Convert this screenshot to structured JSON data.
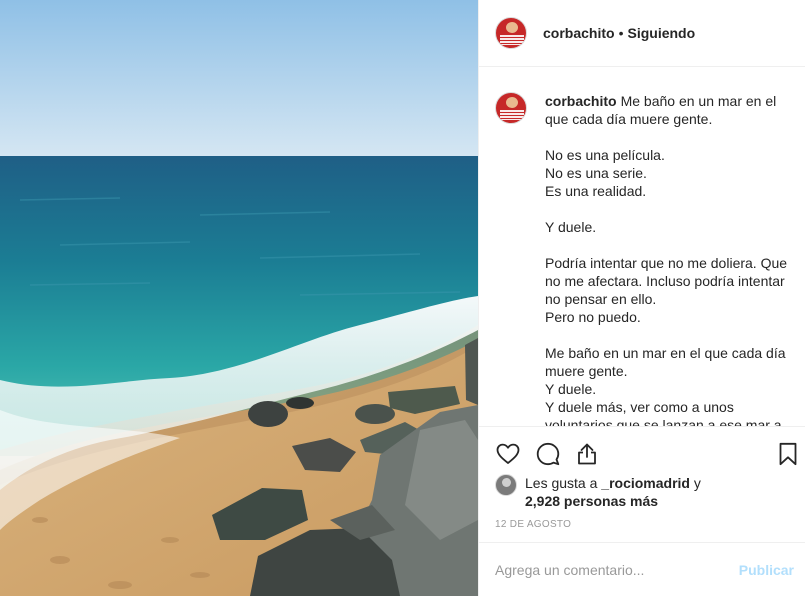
{
  "post": {
    "username": "corbachito",
    "separator": "•",
    "follow_status": "Siguiendo",
    "caption_first": "Me baño en un mar en el que cada día muere gente.",
    "caption_lines": [
      "No es una película.",
      "No es una serie.",
      "Es una realidad.",
      "",
      "Y duele.",
      "",
      "Podría intentar que no me doliera. Que no me afectara. Incluso podría intentar no pensar en ello.",
      "Pero no puedo.",
      "",
      "Me baño en un mar en el que cada día muere gente.",
      "Y duele.",
      "Y duele más, ver como a unos voluntarios que se lanzan a ese mar a"
    ],
    "likes_prefix": "Les gusta a ",
    "likes_user": "_rociomadrid",
    "likes_and": " y",
    "likes_count_text": "2,928 personas más",
    "date": "12 DE AGOSTO",
    "comment_placeholder": "Agrega un comentario...",
    "publish_label": "Publicar"
  },
  "icons": {
    "like": "heart-icon",
    "comment": "comment-bubble-icon",
    "share": "share-icon",
    "save": "bookmark-icon"
  },
  "colors": {
    "text": "#262626",
    "muted": "#999999",
    "border": "#efefef",
    "publish_disabled": "#b2dffc",
    "avatar": "#c62828"
  }
}
